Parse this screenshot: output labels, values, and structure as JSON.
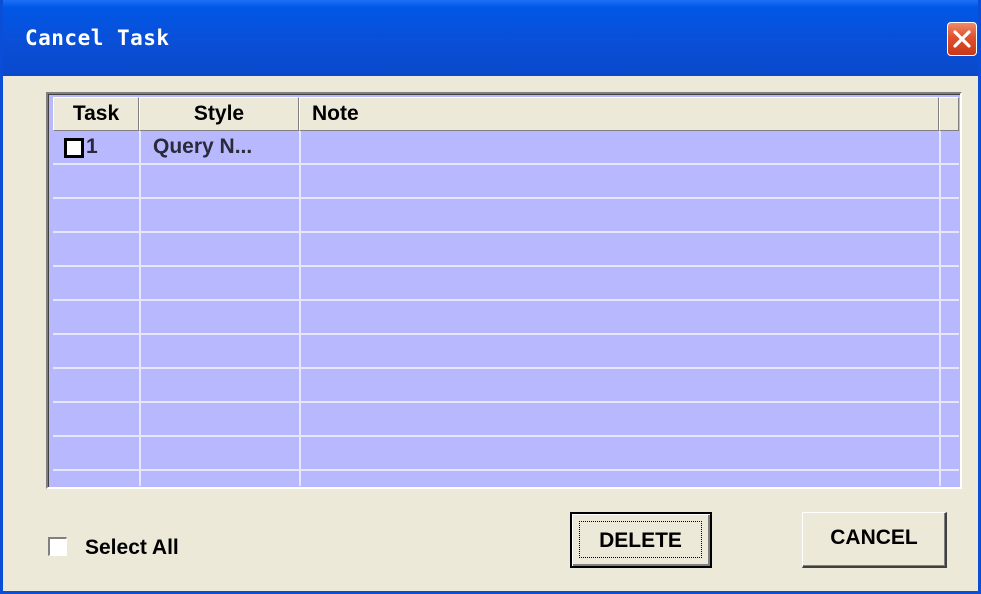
{
  "window": {
    "title": "Cancel Task",
    "close_icon": "close-x-icon"
  },
  "grid": {
    "columns": [
      "Task",
      "Style",
      "Note"
    ],
    "rows": [
      {
        "task": "1",
        "style": "Query N...",
        "note": "",
        "checked": false
      }
    ],
    "empty_row_count": 9,
    "row_background": "#b8b8ff"
  },
  "footer": {
    "select_all_label": "Select All",
    "select_all_checked": false,
    "delete_label": "DELETE",
    "cancel_label": "CANCEL"
  },
  "colors": {
    "titlebar": "#0a4fd7",
    "window_bg": "#ece9d8",
    "close_button": "#e0502c"
  }
}
